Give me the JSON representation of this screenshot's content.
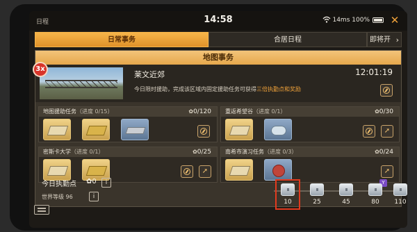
{
  "status_bar": {
    "schedule_label": "日程",
    "time": "14:58",
    "network": "14ms",
    "battery": "100%"
  },
  "tabs": [
    {
      "label": "日常事务",
      "active": true
    },
    {
      "label": "合居日程",
      "active": false
    },
    {
      "label": "即将开放",
      "active": false
    }
  ],
  "panel": {
    "title": "地图事务"
  },
  "feature": {
    "multiplier": "3x",
    "title": "莱文近郊",
    "timer": "12:01:19",
    "desc_prefix": "今日限时援助，完成该区域内固定援助任务可获得",
    "desc_highlight": "三倍执勤点和奖励"
  },
  "tasks": [
    {
      "name": "地图援助任务",
      "progress": "（进度 0/15）",
      "count": "0/120"
    },
    {
      "name": "重返希望谷",
      "progress": "（进度 0/1）",
      "count": "0/30"
    },
    {
      "name": "密斯卡大学",
      "progress": "（进度 0/1）",
      "count": "0/25"
    },
    {
      "name": "南希市演习任务",
      "progress": "（进度 0/3）",
      "count": "0/24"
    }
  ],
  "daily": {
    "label": "今日执勤点",
    "value": "0",
    "info": "i",
    "level_label": "世界等级 96"
  },
  "milestones": [
    "10",
    "25",
    "45",
    "80",
    "110"
  ],
  "milestone_badge": "Y",
  "colors": {
    "accent": "#f0a23a",
    "highlight_box": "#e23a1e",
    "tab_active": "#e0922a"
  }
}
